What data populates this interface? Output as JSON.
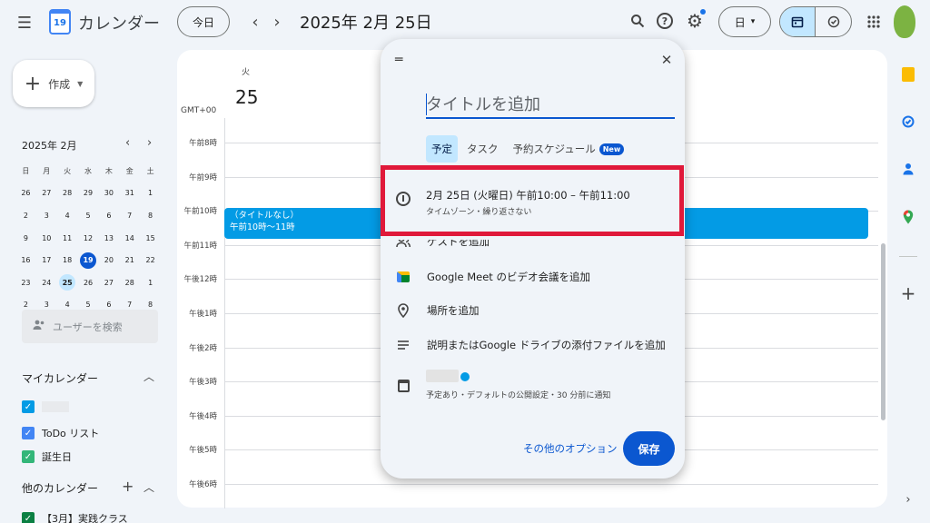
{
  "header": {
    "app_title": "カレンダー",
    "logo_day": "19",
    "today_label": "今日",
    "prev_arrow": "‹",
    "next_arrow": "›",
    "date_title": "2025年 2月 25日",
    "view_label": "日",
    "view_caret": "▾"
  },
  "sidebar": {
    "create_label": "作成",
    "mini_calendar": {
      "title": "2025年 2月",
      "weekdays": [
        "日",
        "月",
        "火",
        "水",
        "木",
        "金",
        "土"
      ],
      "weeks": [
        [
          "26",
          "27",
          "28",
          "29",
          "30",
          "31",
          "1"
        ],
        [
          "2",
          "3",
          "4",
          "5",
          "6",
          "7",
          "8"
        ],
        [
          "9",
          "10",
          "11",
          "12",
          "13",
          "14",
          "15"
        ],
        [
          "16",
          "17",
          "18",
          "19",
          "20",
          "21",
          "22"
        ],
        [
          "23",
          "24",
          "25",
          "26",
          "27",
          "28",
          "1"
        ],
        [
          "2",
          "3",
          "4",
          "5",
          "6",
          "7",
          "8"
        ]
      ],
      "today": "19",
      "selected": "25"
    },
    "user_search_placeholder": "ユーザーを検索",
    "my_calendars_title": "マイカレンダー",
    "my_calendars": [
      {
        "label": "",
        "color": "#039be5"
      },
      {
        "label": "ToDo リスト",
        "color": "#4285f4"
      },
      {
        "label": "誕生日",
        "color": "#33b679"
      }
    ],
    "other_calendars_title": "他のカレンダー",
    "other_calendars": [
      {
        "label": "【3月】実践クラス",
        "color": "#0b8043"
      }
    ]
  },
  "day_view": {
    "weekday": "火",
    "day_number": "25",
    "timezone": "GMT+00",
    "hours": [
      "午前8時",
      "午前9時",
      "午前10時",
      "午前11時",
      "午後12時",
      "午後1時",
      "午後2時",
      "午後3時",
      "午後4時",
      "午後5時",
      "午後6時"
    ],
    "event": {
      "title": "（タイトルなし）",
      "time": "午前10時～11時",
      "color": "#039be5"
    }
  },
  "dialog": {
    "title_placeholder": "タイトルを追加",
    "tabs": [
      {
        "label": "予定",
        "active": true
      },
      {
        "label": "タスク",
        "active": false
      },
      {
        "label": "予約スケジュール",
        "active": false
      }
    ],
    "new_badge": "New",
    "time_main": "2月 25日 (火曜日)   午前10:00  –  午前11:00",
    "time_sub": "タイムゾーン・繰り返さない",
    "options": {
      "guests": "ゲストを追加",
      "meet": "Google Meet のビデオ会議を追加",
      "location": "場所を追加",
      "description": "説明またはGoogle ドライブの添付ファイルを追加"
    },
    "calendar_sub": "予定あり・デフォルトの公開設定・30 分前に通知",
    "more_options": "その他のオプション",
    "save": "保存",
    "highlight_color": "#e0193a"
  }
}
